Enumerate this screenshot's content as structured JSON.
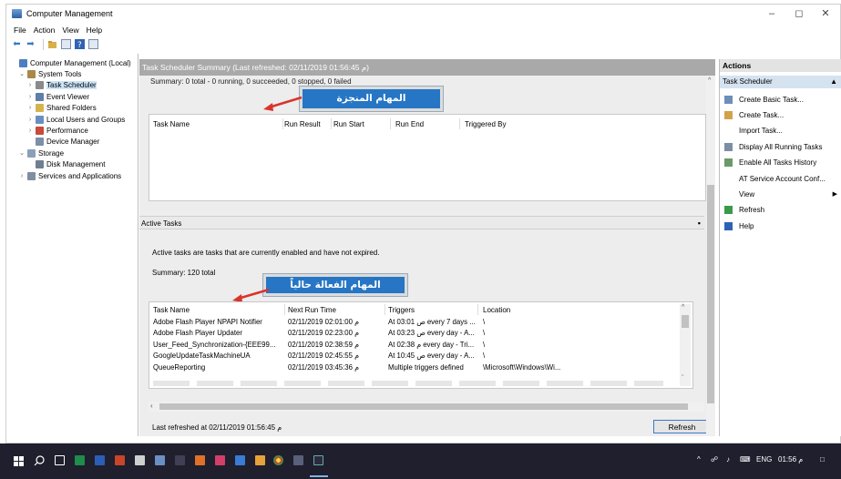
{
  "window": {
    "title": "Computer Management"
  },
  "menu": [
    "File",
    "Action",
    "View",
    "Help"
  ],
  "tree": [
    {
      "label": "Computer Management (Local)",
      "level": 0,
      "expander": "",
      "selected": false,
      "icon_color": "#4d7fc0",
      "icon": "computer-icon"
    },
    {
      "label": "System Tools",
      "level": 1,
      "expander": "v",
      "selected": false,
      "icon_color": "#a7894a",
      "icon": "tools-icon"
    },
    {
      "label": "Task Scheduler",
      "level": 2,
      "expander": ">",
      "selected": true,
      "icon_color": "#8a8a8a",
      "icon": "clock-icon"
    },
    {
      "label": "Event Viewer",
      "level": 2,
      "expander": ">",
      "selected": false,
      "icon_color": "#5f7fa8",
      "icon": "event-viewer-icon"
    },
    {
      "label": "Shared Folders",
      "level": 2,
      "expander": ">",
      "selected": false,
      "icon_color": "#d6b44c",
      "icon": "shared-folder-icon"
    },
    {
      "label": "Local Users and Groups",
      "level": 2,
      "expander": ">",
      "selected": false,
      "icon_color": "#6a8fbf",
      "icon": "users-icon"
    },
    {
      "label": "Performance",
      "level": 2,
      "expander": ">",
      "selected": false,
      "icon_color": "#c84a3a",
      "icon": "performance-icon"
    },
    {
      "label": "Device Manager",
      "level": 2,
      "expander": "",
      "selected": false,
      "icon_color": "#7b8fa6",
      "icon": "device-manager-icon"
    },
    {
      "label": "Storage",
      "level": 1,
      "expander": "v",
      "selected": false,
      "icon_color": "#8aa0b8",
      "icon": "storage-icon"
    },
    {
      "label": "Disk Management",
      "level": 2,
      "expander": "",
      "selected": false,
      "icon_color": "#6f7f8f",
      "icon": "disk-icon"
    },
    {
      "label": "Services and Applications",
      "level": 1,
      "expander": ">",
      "selected": false,
      "icon_color": "#7f8f9f",
      "icon": "services-icon"
    }
  ],
  "summary": {
    "header": "Task Scheduler Summary (Last refreshed: 02/11/2019 01:56:45 م)",
    "status_line": "Summary: 0 total - 0 running, 0 succeeded, 0 stopped, 0 failed",
    "completed_columns": [
      "Task Name",
      "Run Result",
      "Run Start",
      "Run End",
      "Triggered By"
    ],
    "callout_completed": "المهام المنجزة"
  },
  "active": {
    "section_title": "Active Tasks",
    "section_button": "▪",
    "description": "Active tasks are tasks that are currently enabled and have not expired.",
    "summary": "Summary: 120 total",
    "callout_active": "المهام الفعالة حالياً",
    "columns": [
      "Task Name",
      "Next Run Time",
      "Triggers",
      "Location"
    ],
    "rows": [
      [
        "Adobe Flash Player NPAPI Notifier",
        "02/11/2019 02:01:00 م",
        "At 03:01 ص every 7 days ...",
        "\\"
      ],
      [
        "Adobe Flash Player Updater",
        "02/11/2019 02:23:00 م",
        "At 03:23 ص every day - A...",
        "\\"
      ],
      [
        "User_Feed_Synchronization-{EEE99...",
        "02/11/2019 02:38:59 م",
        "At 02:38 م every day - Tri...",
        "\\"
      ],
      [
        "GoogleUpdateTaskMachineUA",
        "02/11/2019 02:45:55 م",
        "At 10:45 ص every day - A...",
        "\\"
      ],
      [
        "QueueReporting",
        "02/11/2019 03:45:36 م",
        "Multiple triggers defined",
        "\\Microsoft\\Windows\\Wi..."
      ]
    ],
    "last_refreshed": "Last refreshed at 02/11/2019 01:56:45 م",
    "refresh_button": "Refresh"
  },
  "actions": {
    "header": "Actions",
    "subheader": "Task Scheduler",
    "items": [
      {
        "label": "Create Basic Task...",
        "icon": "create-basic-task-icon",
        "icon_color": "#6b8fb8"
      },
      {
        "label": "Create Task...",
        "icon": "create-task-icon",
        "icon_color": "#d2a24a"
      },
      {
        "label": "Import Task...",
        "icon": "",
        "icon_color": ""
      },
      {
        "label": "Display All Running Tasks",
        "icon": "running-tasks-icon",
        "icon_color": "#7c8ea3"
      },
      {
        "label": "Enable All Tasks History",
        "icon": "history-icon",
        "icon_color": "#6a9a6a"
      },
      {
        "label": "AT Service Account Conf...",
        "icon": "",
        "icon_color": ""
      },
      {
        "label": "View",
        "icon": "",
        "icon_color": "",
        "submenu": "▶"
      },
      {
        "label": "Refresh",
        "icon": "refresh-icon",
        "icon_color": "#3a9a4a"
      },
      {
        "label": "Help",
        "icon": "help-icon",
        "icon_color": "#2f62b3"
      }
    ]
  },
  "taskbar": {
    "lang": "ENG",
    "time": "01:56 م"
  },
  "colors": {
    "accent": "#2676c5",
    "arrow": "#d9342b",
    "taskbar": "#1f1f2d"
  }
}
